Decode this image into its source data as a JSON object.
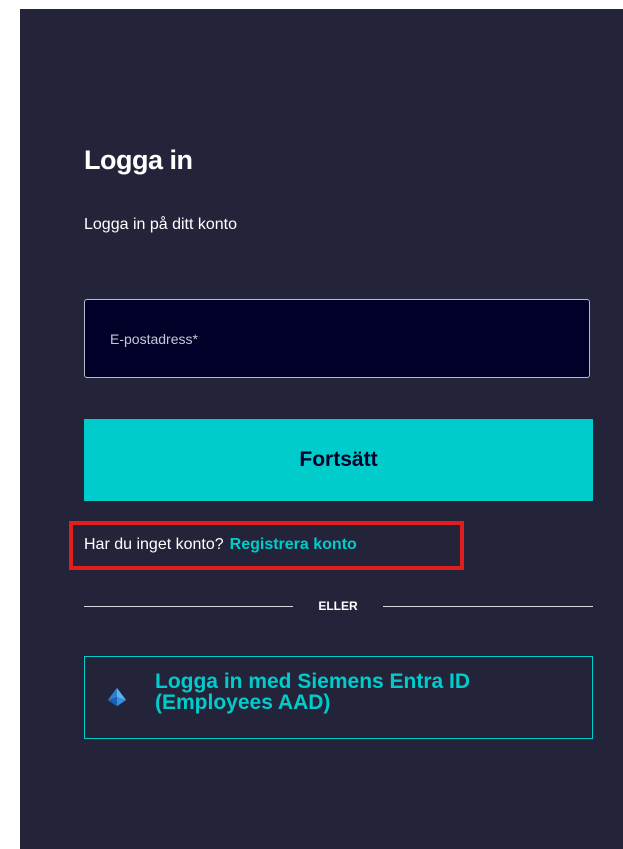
{
  "login": {
    "title": "Logga in",
    "subtitle": "Logga in på ditt konto",
    "email_placeholder": "E-postadress*",
    "email_value": "",
    "continue_label": "Fortsätt",
    "no_account_text": "Har du inget konto?",
    "register_link": "Registrera konto",
    "divider_text": "ELLER",
    "sso_label": "Logga in med Siemens Entra ID (Employees AAD)",
    "sso_icon": "entra-id-icon"
  },
  "colors": {
    "background": "#23233a",
    "accent": "#00cccc",
    "input_background": "#000028",
    "highlight": "#e01e1e"
  }
}
